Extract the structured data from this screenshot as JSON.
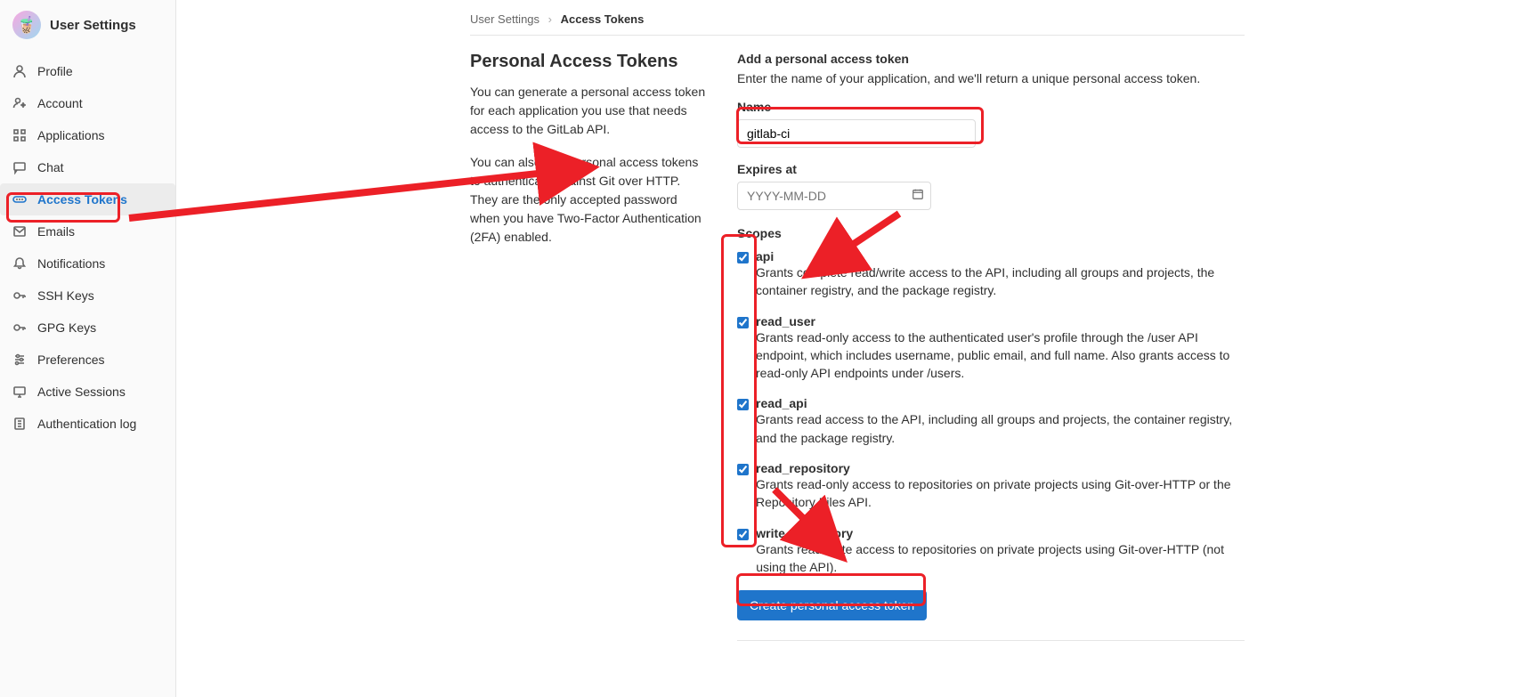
{
  "sidebar": {
    "title": "User Settings",
    "items": [
      {
        "icon": "profile",
        "label": "Profile"
      },
      {
        "icon": "account",
        "label": "Account"
      },
      {
        "icon": "applications",
        "label": "Applications"
      },
      {
        "icon": "chat",
        "label": "Chat"
      },
      {
        "icon": "token",
        "label": "Access Tokens",
        "active": true
      },
      {
        "icon": "email",
        "label": "Emails"
      },
      {
        "icon": "notif",
        "label": "Notifications"
      },
      {
        "icon": "key",
        "label": "SSH Keys"
      },
      {
        "icon": "key",
        "label": "GPG Keys"
      },
      {
        "icon": "prefs",
        "label": "Preferences"
      },
      {
        "icon": "monitor",
        "label": "Active Sessions"
      },
      {
        "icon": "log",
        "label": "Authentication log"
      }
    ]
  },
  "breadcrumbs": {
    "parent": "User Settings",
    "current": "Access Tokens"
  },
  "main": {
    "title": "Personal Access Tokens",
    "p1": "You can generate a personal access token for each application you use that needs access to the GitLab API.",
    "p2": "You can also use personal access tokens to authenticate against Git over HTTP. They are the only accepted password when you have Two-Factor Authentication (2FA) enabled."
  },
  "form": {
    "heading": "Add a personal access token",
    "sub": "Enter the name of your application, and we'll return a unique personal access token.",
    "name_label": "Name",
    "name_value": "gitlab-ci",
    "expires_label": "Expires at",
    "expires_placeholder": "YYYY-MM-DD",
    "scopes_label": "Scopes",
    "scopes": [
      {
        "key": "api",
        "label": "api",
        "desc": "Grants complete read/write access to the API, including all groups and projects, the container registry, and the package registry.",
        "checked": true
      },
      {
        "key": "read_user",
        "label": "read_user",
        "desc": "Grants read-only access to the authenticated user's profile through the /user API endpoint, which includes username, public email, and full name. Also grants access to read-only API endpoints under /users.",
        "checked": true
      },
      {
        "key": "read_api",
        "label": "read_api",
        "desc": "Grants read access to the API, including all groups and projects, the container registry, and the package registry.",
        "checked": true
      },
      {
        "key": "read_repository",
        "label": "read_repository",
        "desc": "Grants read-only access to repositories on private projects using Git-over-HTTP or the Repository Files API.",
        "checked": true
      },
      {
        "key": "write_repository",
        "label": "write_repository",
        "desc": "Grants read-write access to repositories on private projects using Git-over-HTTP (not using the API).",
        "checked": true
      }
    ],
    "submit": "Create personal access token"
  },
  "annotation_color": "#ec2027"
}
